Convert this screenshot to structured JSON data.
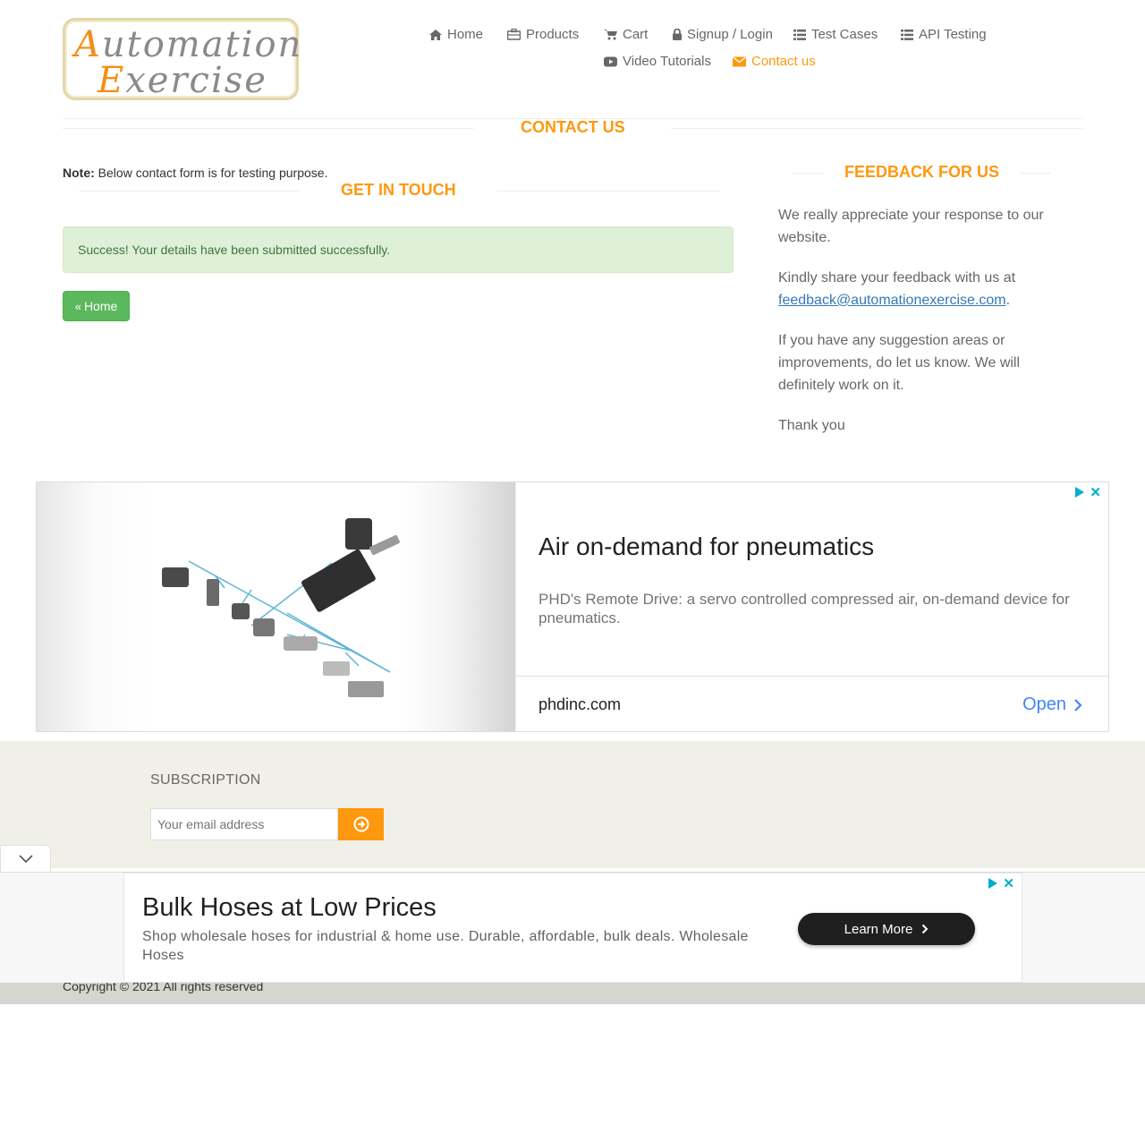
{
  "logo": {
    "line1_cap": "A",
    "line1_rest": "utomation",
    "line2_cap": "E",
    "line2_rest": "xercise"
  },
  "nav": {
    "items": [
      {
        "label": "Home",
        "icon": "home-icon"
      },
      {
        "label": "Products",
        "icon": "briefcase-icon"
      },
      {
        "label": "Cart",
        "icon": "cart-icon"
      },
      {
        "label": "Signup / Login",
        "icon": "lock-icon"
      },
      {
        "label": "Test Cases",
        "icon": "list-icon"
      },
      {
        "label": "API Testing",
        "icon": "list-icon"
      },
      {
        "label": "Video Tutorials",
        "icon": "youtube-icon"
      },
      {
        "label": "Contact us",
        "icon": "envelope-icon",
        "active": true
      }
    ]
  },
  "contact": {
    "title": "CONTACT US",
    "note_label": "Note:",
    "note_text": "Below contact form is for testing purpose.",
    "get_in_touch": "GET IN TOUCH",
    "success": "Success! Your details have been submitted successfully.",
    "home_button": "Home"
  },
  "feedback": {
    "title": "FEEDBACK FOR US",
    "p1": "We really appreciate your response to our website.",
    "p2_prefix": "Kindly share your feedback with us at",
    "email": "feedback@automationexercise.com",
    "p2_suffix": ".",
    "p3": "If you have any suggestion areas or improvements, do let us know. We will definitely work on it.",
    "p4": "Thank you"
  },
  "ad1": {
    "headline": "Air on-demand for pneumatics",
    "description": "PHD's Remote Drive: a servo controlled compressed air, on-demand device for pneumatics.",
    "domain": "phdinc.com",
    "cta": "Open"
  },
  "footer": {
    "subscription_title": "SUBSCRIPTION",
    "email_placeholder": "Your email address",
    "copyright": "Copyright © 2021 All rights reserved"
  },
  "ad2": {
    "headline": "Bulk Hoses at Low Prices",
    "description": "Shop wholesale hoses for industrial & home use. Durable, affordable, bulk deals. Wholesale Hoses",
    "cta": "Learn More"
  },
  "colors": {
    "accent": "#fe980f",
    "success_bg": "#dff0d8",
    "success_text": "#3c763d",
    "button_green": "#5cb85c",
    "footer_bg": "#f0f0e9",
    "link": "#337ab7",
    "ad_blue": "#4285f4"
  }
}
